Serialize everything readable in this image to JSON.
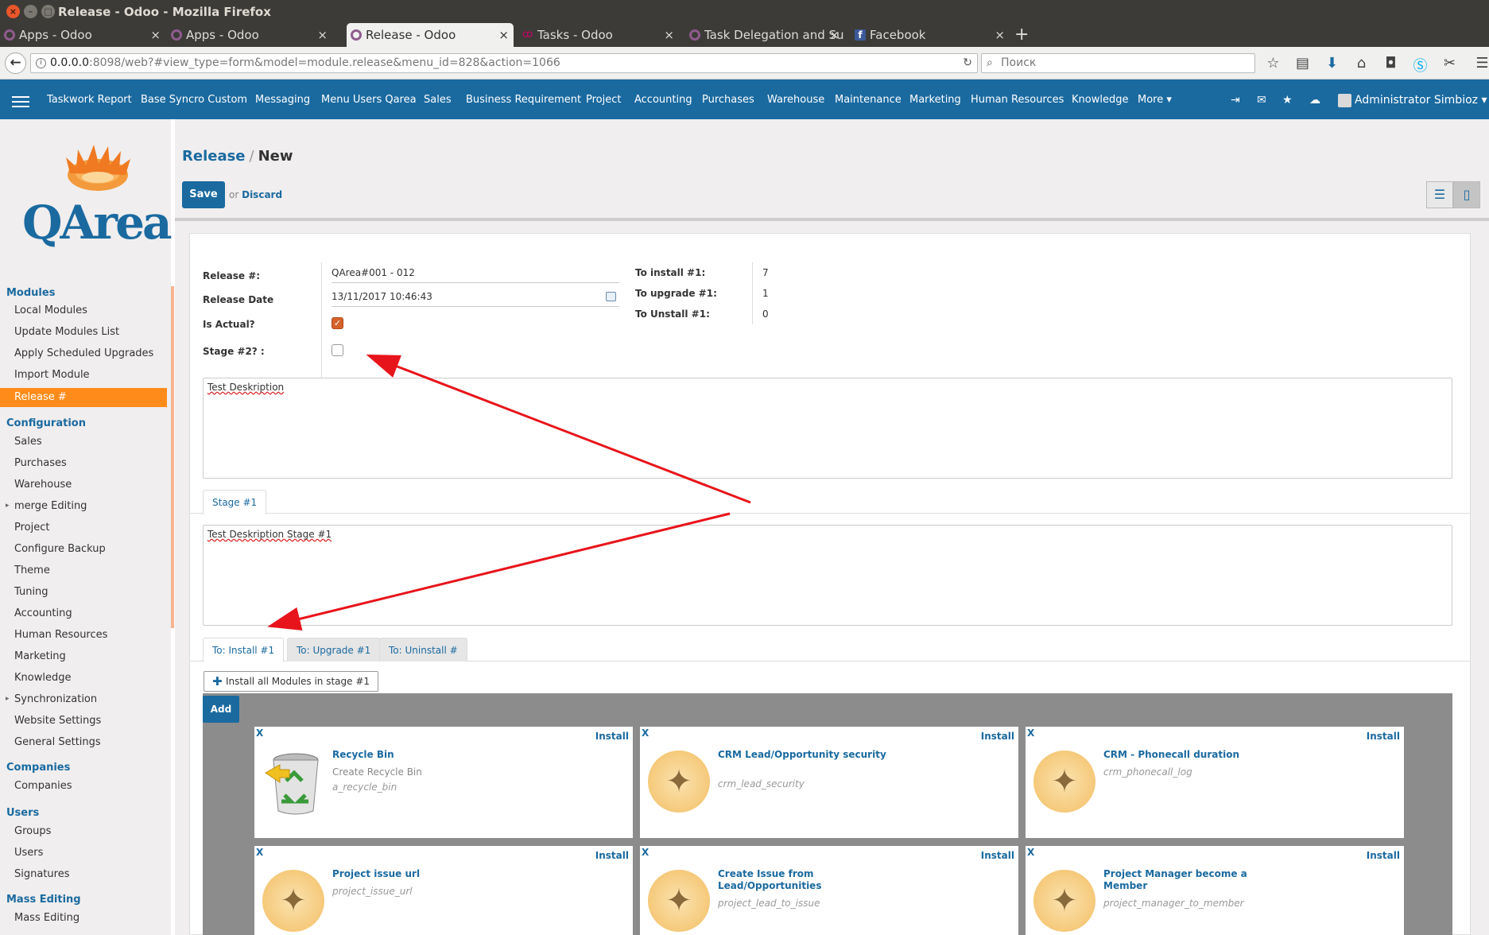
{
  "window": {
    "title": "Release - Odoo - Mozilla Firefox",
    "buttons": [
      "×",
      "–",
      "□"
    ]
  },
  "browser_tabs": [
    {
      "label": "Apps - Odoo",
      "close": "×"
    },
    {
      "label": "Apps - Odoo",
      "close": "×"
    },
    {
      "label": "Release - Odoo",
      "close": "×"
    },
    {
      "label": "Tasks - Odoo",
      "close": "×"
    },
    {
      "label": "Task Delegation and Su",
      "close": "×"
    },
    {
      "label": "Facebook",
      "close": "×"
    }
  ],
  "new_tab": "+",
  "url": {
    "host": "0.0.0.0",
    "rest": ":8098/web?#view_type=form&model=module.release&menu_id=828&action=1066"
  },
  "search": {
    "placeholder": "Поиск"
  },
  "odoo_menu": [
    "Taskwork Report",
    "Base Syncro Custom",
    "Messaging",
    "Menu Users Qarea",
    "Sales",
    "Business Requirement",
    "Project",
    "Accounting",
    "Purchases",
    "Warehouse",
    "Maintenance",
    "Marketing",
    "Human Resources",
    "Knowledge",
    "More ▾"
  ],
  "user": {
    "name": "Administrator Simbioz ▾"
  },
  "logo": {
    "text": "QArea"
  },
  "sidebar": {
    "modules_title": "Modules",
    "modules": [
      "Local Modules",
      "Update Modules List",
      "Apply Scheduled Upgrades",
      "Import Module",
      "Release #"
    ],
    "config_title": "Configuration",
    "config": [
      "Sales",
      "Purchases",
      "Warehouse",
      "merge Editing",
      "Project",
      "Configure Backup",
      "Theme",
      "Tuning",
      "Accounting",
      "Human Resources",
      "Marketing",
      "Knowledge",
      "Synchronization",
      "Website Settings",
      "General Settings"
    ],
    "companies_title": "Companies",
    "companies": [
      "Companies"
    ],
    "users_title": "Users",
    "users": [
      "Groups",
      "Users",
      "Signatures"
    ],
    "mass_title": "Mass Editing",
    "mass": [
      "Mass Editing"
    ]
  },
  "breadcrumb": {
    "parent": "Release",
    "sep": "/",
    "current": "New"
  },
  "actions": {
    "save": "Save",
    "or": "or",
    "discard": "Discard"
  },
  "form": {
    "release_no_label": "Release #:",
    "release_no_value": "QArea#001 - 012",
    "release_date_label": "Release Date",
    "release_date_value": "13/11/2017 10:46:43",
    "is_actual_label": "Is Actual?",
    "is_actual": true,
    "stage2_label": "Stage #2? :",
    "stage2": false,
    "to_install_label": "To install #1:",
    "to_install_value": "7",
    "to_upgrade_label": "To upgrade #1:",
    "to_upgrade_value": "1",
    "to_unstall_label": "To Unstall #1:",
    "to_unstall_value": "0",
    "description": "Test Deskription",
    "stage_tab": "Stage #1",
    "stage_description": "Test Deskription Stage #1",
    "module_tabs": [
      "To: Install #1",
      "To: Upgrade #1",
      "To: Uninstall #"
    ],
    "install_all": "Install all Modules in stage #1",
    "add": "Add"
  },
  "cards": [
    {
      "x": "X",
      "install": "Install",
      "title": "Recycle Bin",
      "desc": "Create Recycle Bin",
      "tech": "a_recycle_bin",
      "icon": "recycle-bin-icon"
    },
    {
      "x": "X",
      "install": "Install",
      "title": "CRM Lead/Opportunity security",
      "desc": "",
      "tech": "crm_lead_security",
      "icon": "vitruvian-icon"
    },
    {
      "x": "X",
      "install": "Install",
      "title": "CRM - Phonecall duration",
      "desc": "",
      "tech": "crm_phonecall_log",
      "icon": "vitruvian-icon"
    },
    {
      "x": "X",
      "install": "Install",
      "title": "Project issue url",
      "desc": "",
      "tech": "project_issue_url",
      "icon": "vitruvian-icon"
    },
    {
      "x": "X",
      "install": "Install",
      "title": "Create Issue from Lead/Opportunities",
      "desc": "",
      "tech": "project_lead_to_issue",
      "icon": "vitruvian-icon"
    },
    {
      "x": "X",
      "install": "Install",
      "title": "Project Manager become a Member",
      "desc": "",
      "tech": "project_manager_to_member",
      "icon": "vitruvian-icon"
    }
  ],
  "colors": {
    "brand": "#1a6aa0",
    "active_menu": "#ff8c1a",
    "arrow": "#e8141b"
  }
}
